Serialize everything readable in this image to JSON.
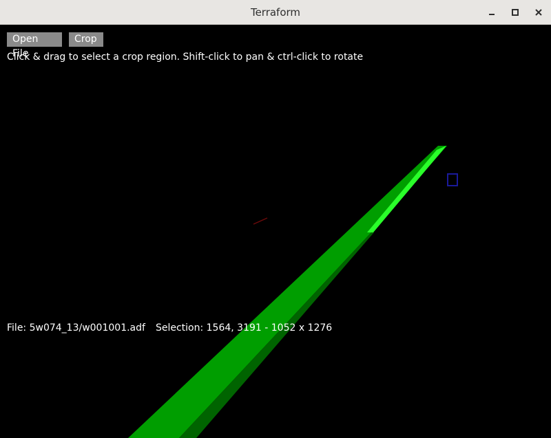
{
  "window": {
    "title": "Terraform"
  },
  "toolbar": {
    "open_file_label": "Open File",
    "crop_label": "Crop"
  },
  "hint": "Click & drag to select a crop region. Shift-click to pan & ctrl-click to rotate",
  "status": {
    "file": "File: 5w074_13/w001001.adf",
    "selection": "Selection: 1564, 3191 - 1052 x 1276"
  },
  "colors": {
    "canvas_bg": "#000000",
    "terrain_top": "#009e00",
    "terrain_side": "#006400",
    "terrain_highlight": "#2aff2a",
    "button_bg": "#8a8a8a",
    "marker": "#1a1a9a"
  },
  "icons": {
    "minimize": "minimize-icon",
    "maximize": "maximize-icon",
    "close": "close-icon"
  }
}
